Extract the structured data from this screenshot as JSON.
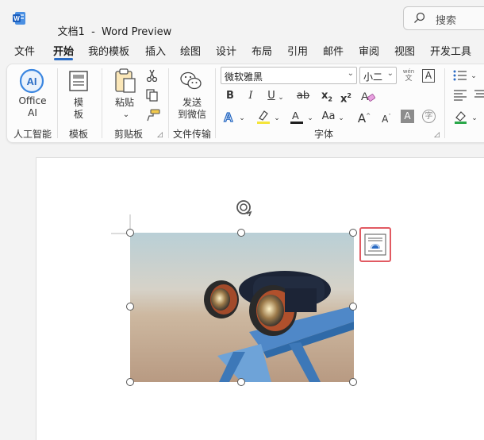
{
  "titlebar": {
    "doc_name": "文档1",
    "separator": "-",
    "app_name": "Word Preview",
    "search_label": "搜索"
  },
  "tabs": [
    {
      "label": "文件",
      "active": false
    },
    {
      "label": "开始",
      "active": true
    },
    {
      "label": "我的模板",
      "active": false
    },
    {
      "label": "插入",
      "active": false
    },
    {
      "label": "绘图",
      "active": false
    },
    {
      "label": "设计",
      "active": false
    },
    {
      "label": "布局",
      "active": false
    },
    {
      "label": "引用",
      "active": false
    },
    {
      "label": "邮件",
      "active": false
    },
    {
      "label": "审阅",
      "active": false
    },
    {
      "label": "视图",
      "active": false
    },
    {
      "label": "开发工具",
      "active": false
    }
  ],
  "ribbon": {
    "office_ai": {
      "line1": "Office",
      "line2": "AI",
      "group": "人工智能"
    },
    "template": {
      "line1": "模",
      "line2": "板",
      "group": "模板"
    },
    "clipboard": {
      "paste": "粘贴",
      "group": "剪贴板"
    },
    "transfer": {
      "line1": "发送",
      "line2": "到微信",
      "group": "文件传输"
    },
    "font": {
      "name": "微软雅黑",
      "size": "小二",
      "group": "字体",
      "bold": "B",
      "italic": "I",
      "underline": "U",
      "strike": "ab",
      "subscript": "x",
      "superscript": "x",
      "case_btn": "Aa",
      "grow": "A",
      "shrink": "A",
      "phonetic_top": "wén",
      "phonetic_bottom": "文",
      "border_char": "A",
      "shade_char": "A",
      "enclose_char": "字"
    }
  },
  "colors": {
    "accent": "#2b6cc4",
    "highlight": "#f5e53a",
    "font_color": "#1f1f1f",
    "layout_border": "#e15a62"
  }
}
